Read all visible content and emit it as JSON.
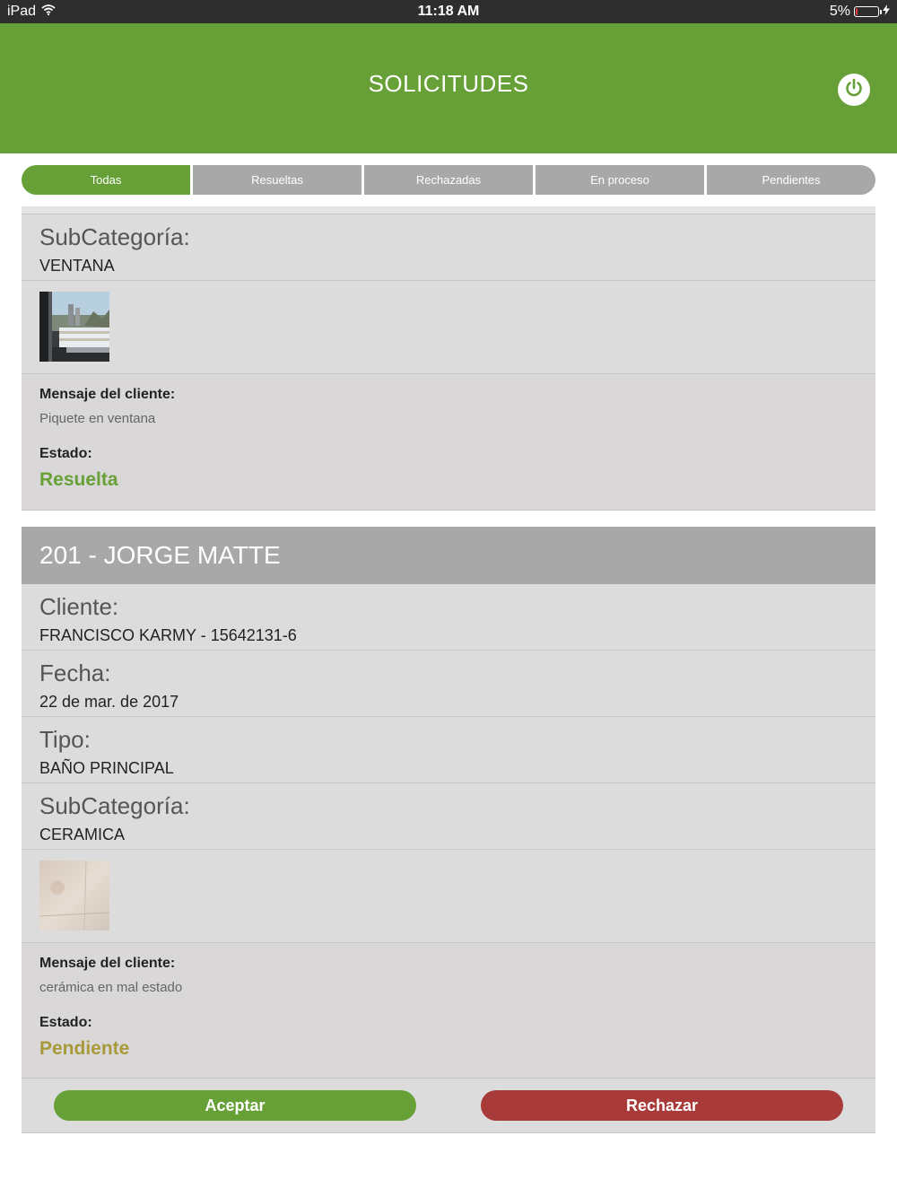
{
  "status_bar": {
    "device": "iPad",
    "time": "11:18 AM",
    "battery_pct_label": "5%",
    "battery_level": 0.05
  },
  "header": {
    "title": "SOLICITUDES"
  },
  "tabs": [
    {
      "label": "Todas",
      "active": true
    },
    {
      "label": "Resueltas",
      "active": false
    },
    {
      "label": "Rechazadas",
      "active": false
    },
    {
      "label": "En proceso",
      "active": false
    },
    {
      "label": "Pendientes",
      "active": false
    }
  ],
  "cards": [
    {
      "subcategory_label": "SubCategoría:",
      "subcategory_value": "VENTANA",
      "message_label": "Mensaje del cliente:",
      "message": "Piquete en ventana",
      "status_label": "Estado:",
      "status": "Resuelta",
      "status_color": "#66a036"
    },
    {
      "title": "201 - JORGE MATTE",
      "client_label": "Cliente:",
      "client_value": "FRANCISCO KARMY - 15642131-6",
      "date_label": "Fecha:",
      "date_value": "22 de mar. de 2017",
      "type_label": "Tipo:",
      "type_value": "BAÑO PRINCIPAL",
      "subcategory_label": "SubCategoría:",
      "subcategory_value": "CERAMICA",
      "message_label": "Mensaje del cliente:",
      "message": "cerámica en mal estado",
      "status_label": "Estado:",
      "status": "Pendiente",
      "status_color": "#a89a3a",
      "accept_label": "Aceptar",
      "reject_label": "Rechazar"
    }
  ],
  "colors": {
    "brand_green": "#66a036",
    "tab_inactive": "#a8a8a8",
    "reject_red": "#a83a3a"
  }
}
